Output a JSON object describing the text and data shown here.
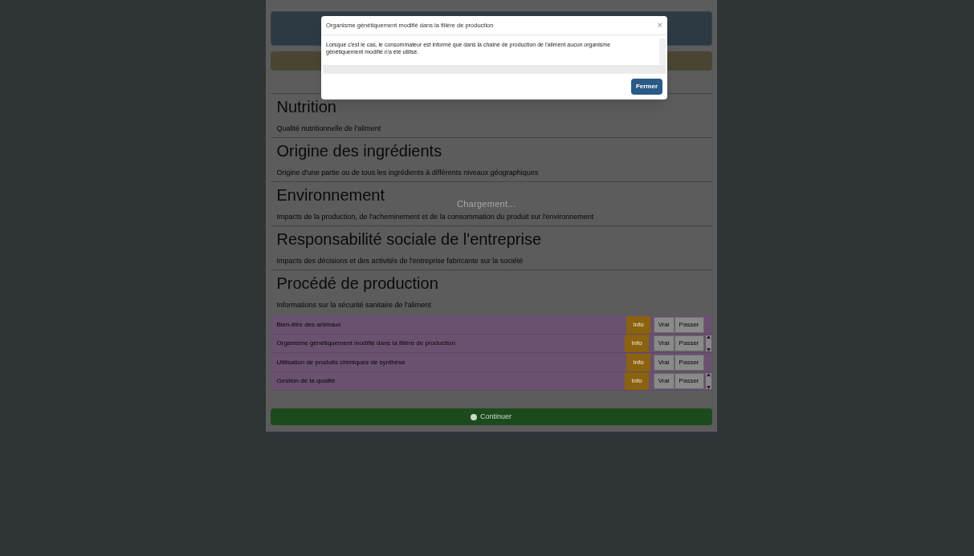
{
  "modal": {
    "title": "Organisme génétiquement modifié dans la filière de production",
    "close": "×",
    "body": "Lorsque c'est le cas, le consommateur est informé que dans la chaîne de production de l'aliment aucun organisme génétiquement modifié n'a été utilisé.",
    "button": "Fermer"
  },
  "loading": "Chargement...",
  "sections": [
    {
      "title": "Nutrition",
      "description": "Qualité nutritionnelle de l'aliment"
    },
    {
      "title": "Origine des ingrédients",
      "description": "Origine d'une partie ou de tous les ingrédients à différents niveaux géographiques"
    },
    {
      "title": "Environnement",
      "description": "Impacts de la production, de l'acheminement et de la consommation du produit sur l'environnement"
    },
    {
      "title": "Responsabilité sociale de l'entreprise",
      "description": "Impacts des décisions et des activités de l'entreprise fabricante sur la société"
    },
    {
      "title": "Procédé de production",
      "description": "Informations sur la sécurité sanitaire de l'aliment"
    }
  ],
  "criteria": [
    {
      "label": "Bien-être des animaux",
      "info": "Info",
      "yes": "Vrai",
      "no": "Passer",
      "spinner": false
    },
    {
      "label": "Organisme génétiquement modifié dans la filière de production",
      "info": "Info",
      "yes": "Vrai",
      "no": "Passer",
      "spinner": true
    },
    {
      "label": "Utilisation de produits chimiques de synthèse",
      "info": "Info",
      "yes": "Vrai",
      "no": "Passer",
      "spinner": false
    },
    {
      "label": "Gestion de la qualité",
      "info": "Info",
      "yes": "Vrai",
      "no": "Passer",
      "spinner": true
    }
  ],
  "continue": "Continuer"
}
